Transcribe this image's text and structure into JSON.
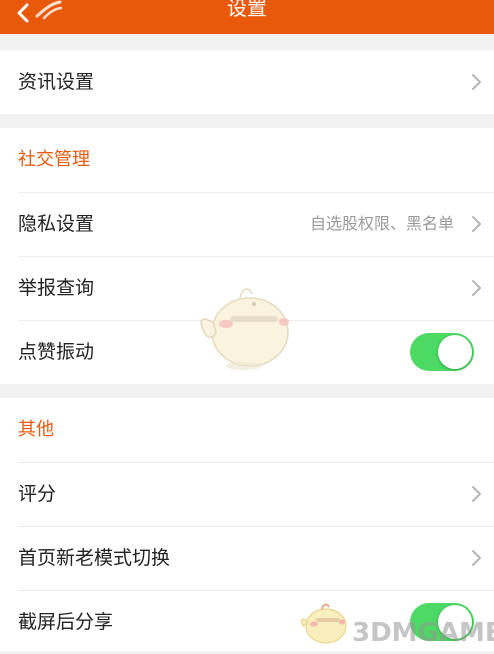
{
  "header": {
    "title": "设置",
    "background_color": "#e8590c"
  },
  "sections": {
    "news": {
      "rows": [
        {
          "label": "资讯设置"
        }
      ]
    },
    "social": {
      "title": "社交管理",
      "rows": [
        {
          "label": "隐私设置",
          "value": "自选股权限、黑名单"
        },
        {
          "label": "举报查询"
        },
        {
          "label": "点赞振动",
          "toggle": true
        }
      ]
    },
    "other": {
      "title": "其他",
      "rows": [
        {
          "label": "评分"
        },
        {
          "label": "首页新老模式切换"
        },
        {
          "label": "截屏后分享",
          "toggle": true
        }
      ]
    }
  },
  "colors": {
    "accent": "#e8590c",
    "toggle_on": "#4cd964"
  },
  "watermark": {
    "text": "3DMGAME"
  }
}
